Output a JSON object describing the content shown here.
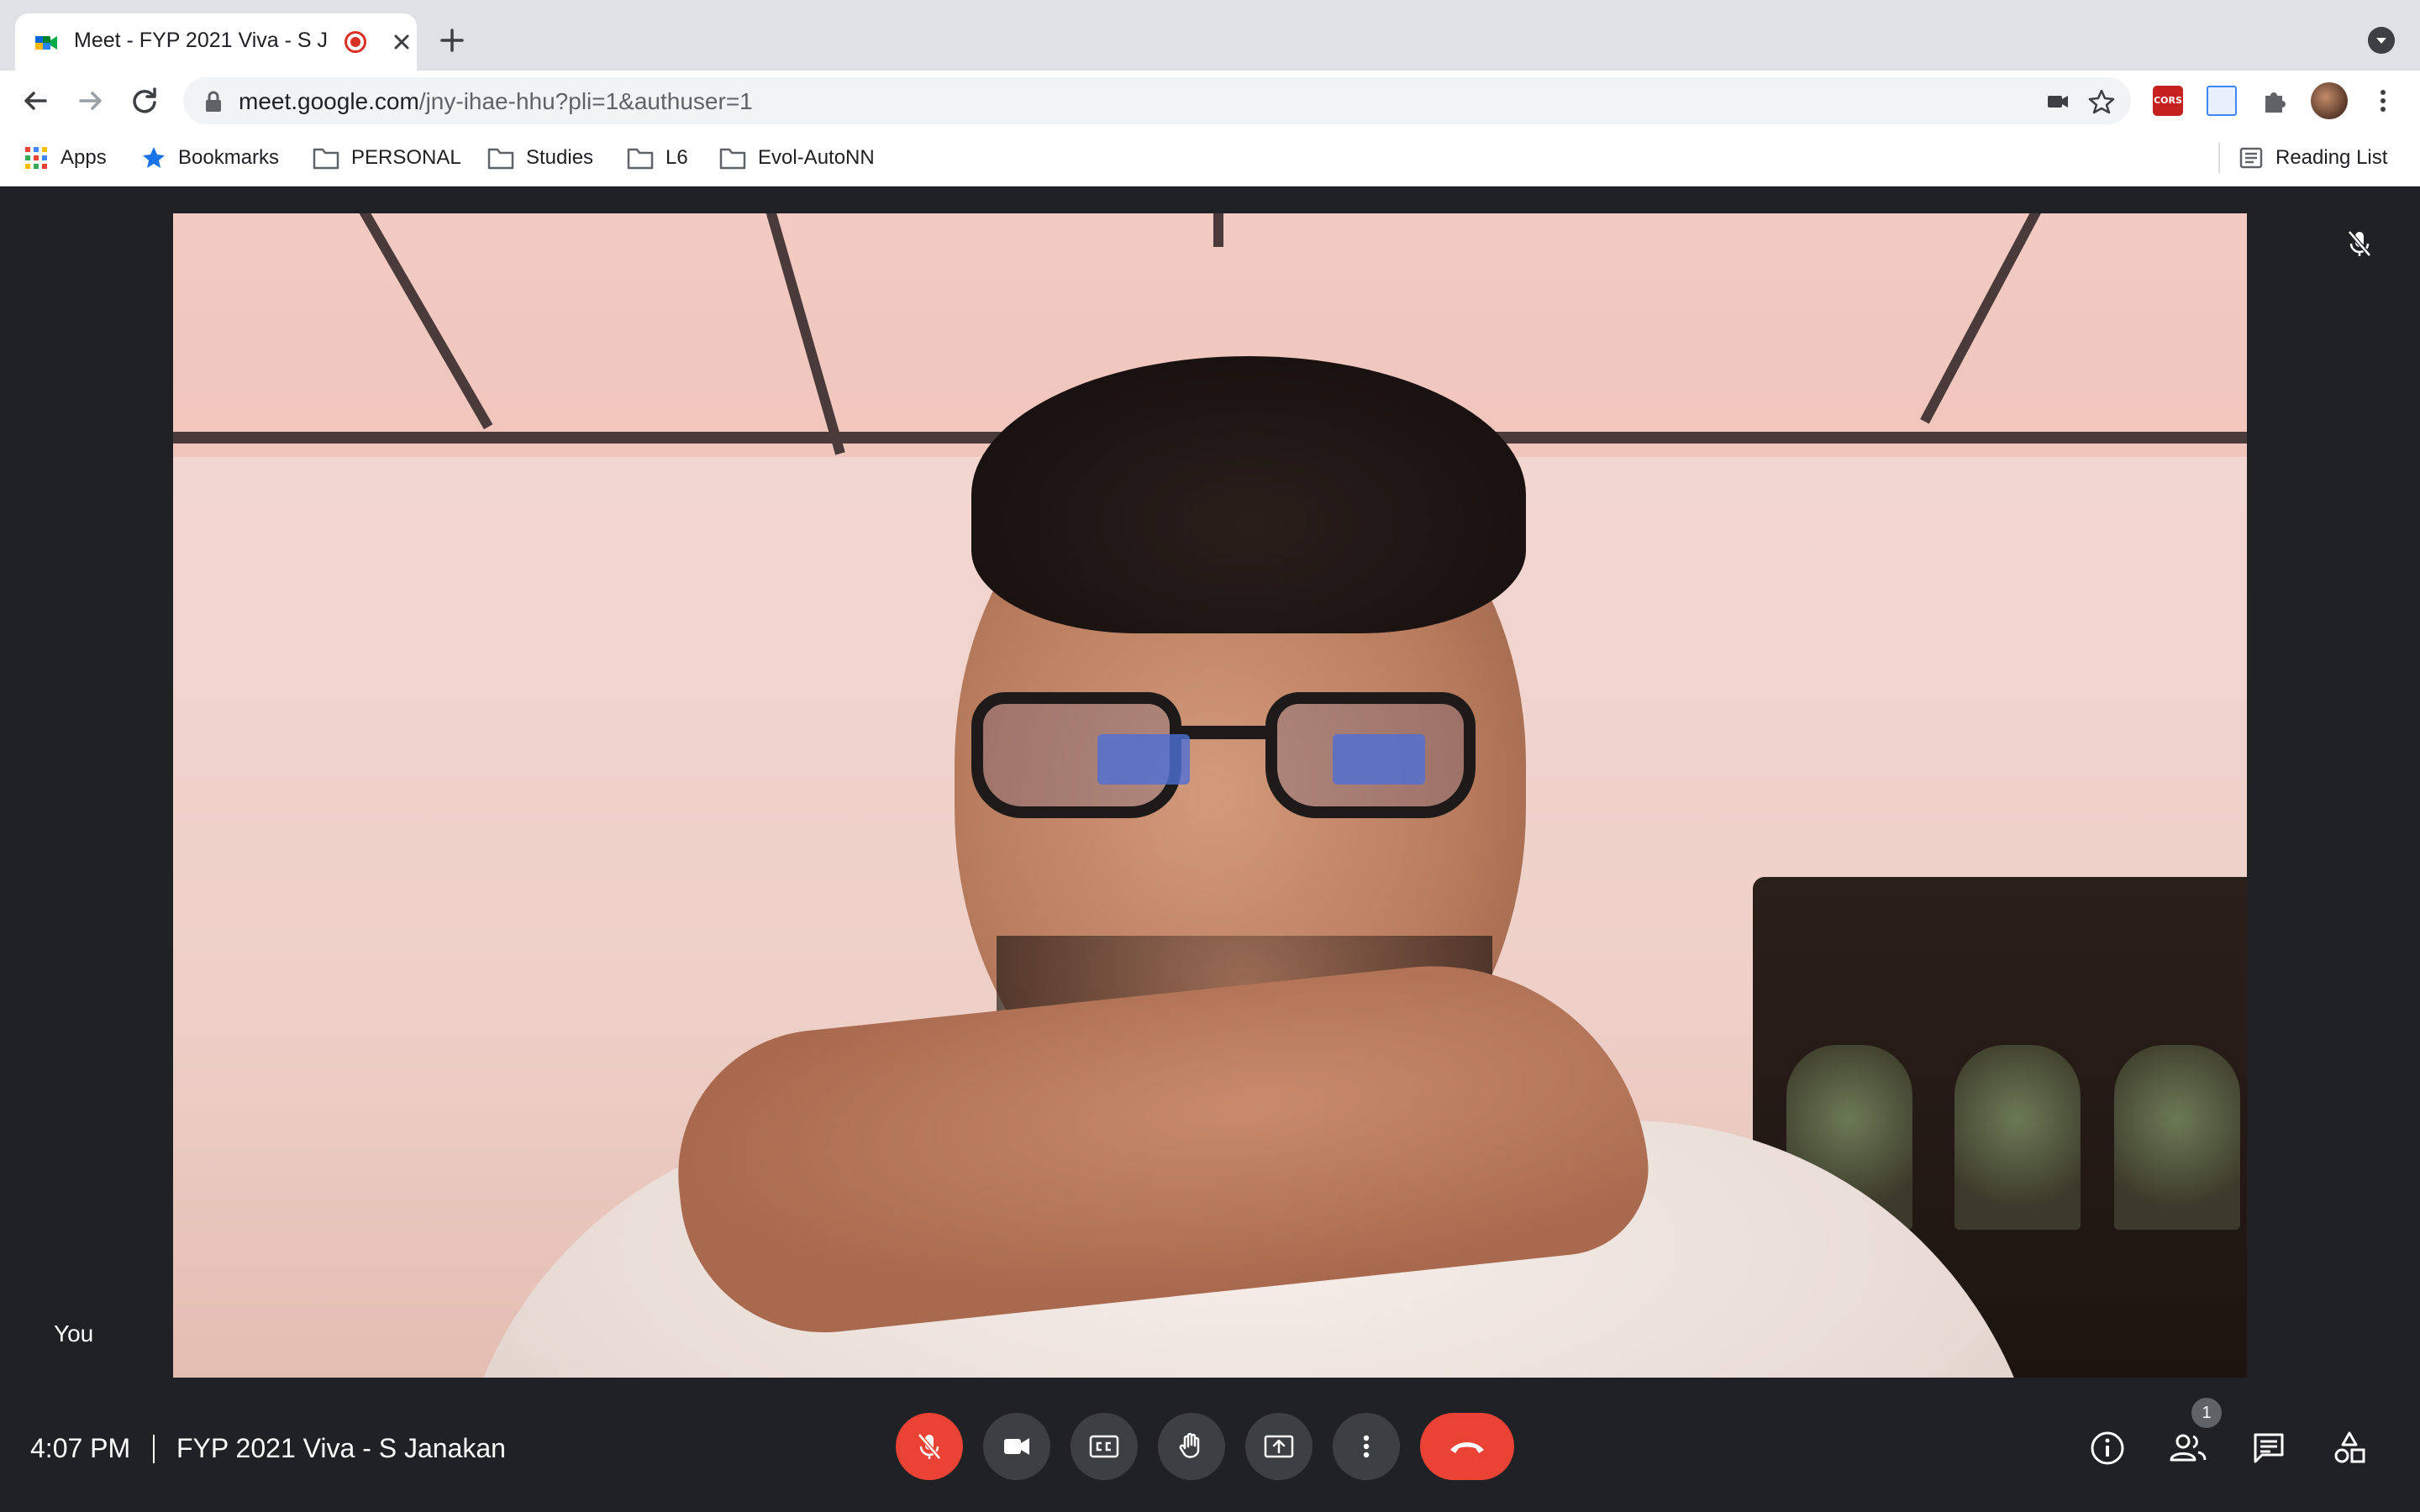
{
  "browser": {
    "tab": {
      "title": "Meet - FYP 2021 Viva - S J",
      "favicon": "google-meet-icon",
      "recording": true
    },
    "url": {
      "host": "meet.google.com",
      "path": "/jny-ihae-hhu?pli=1&authuser=1"
    },
    "extensions": [
      {
        "name": "cors-extension",
        "label": "CORS"
      },
      {
        "name": "docs-extension"
      },
      {
        "name": "extensions-puzzle-icon"
      }
    ],
    "bookmarks": [
      {
        "label": "Apps",
        "icon": "apps-grid-icon"
      },
      {
        "label": "Bookmarks",
        "icon": "star-icon"
      },
      {
        "label": "PERSONAL",
        "icon": "folder-icon"
      },
      {
        "label": "Studies",
        "icon": "folder-icon"
      },
      {
        "label": "L6",
        "icon": "folder-icon"
      },
      {
        "label": "Evol-AutoNN",
        "icon": "folder-icon"
      }
    ],
    "reading_list": "Reading List"
  },
  "meet": {
    "self_label": "You",
    "time": "4:07 PM",
    "meeting_title": "FYP 2021 Viva - S Janakan",
    "participants_count": "1",
    "mic_muted": true,
    "controls": [
      "mic-off",
      "camera",
      "captions",
      "raise-hand",
      "present",
      "more-options",
      "leave-call"
    ],
    "side_controls": [
      "meeting-details",
      "people",
      "chat",
      "activities"
    ],
    "colors": {
      "danger": "#ea4335",
      "control_bg": "#3c4043",
      "stage_bg": "#202124"
    }
  }
}
